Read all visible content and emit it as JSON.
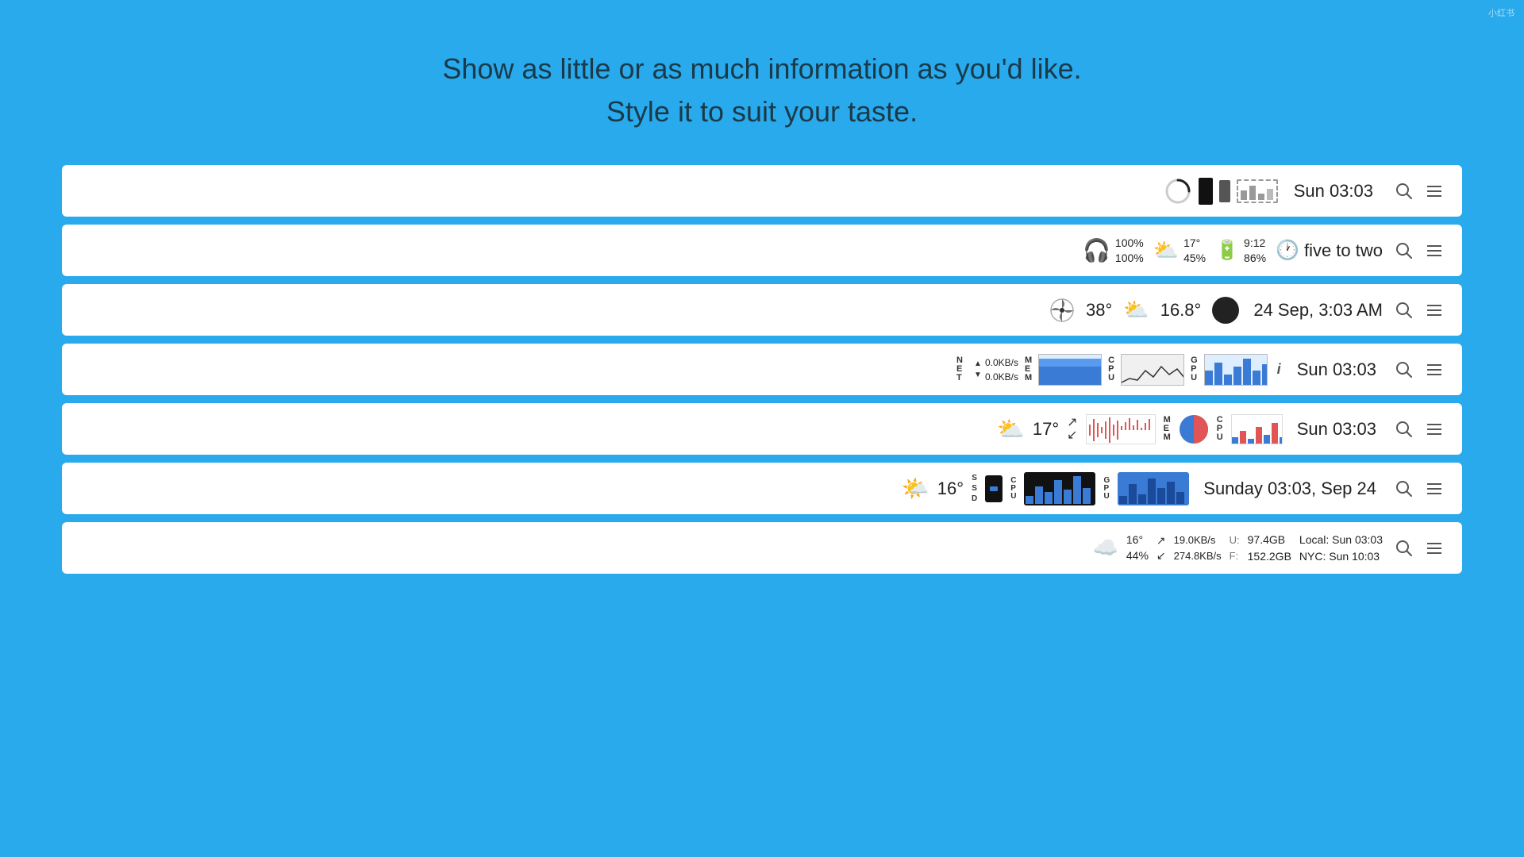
{
  "watermark": "小红书",
  "headline": {
    "line1": "Show as little or as much information as you'd like.",
    "line2": "Style it to suit your taste."
  },
  "bar1": {
    "date": "Sun 03:03"
  },
  "bar2": {
    "headphone_pct1": "100%",
    "headphone_pct2": "100%",
    "weather_temp": "17°",
    "weather_pct": "45%",
    "battery_time": "9:12",
    "battery_pct": "86%",
    "clock_text": "five to two"
  },
  "bar3": {
    "cpu_temp": "38°",
    "weather_temp": "16.8°",
    "datetime": "24 Sep, 3:03 AM"
  },
  "bar4": {
    "net_up": "0.0KB/s",
    "net_down": "0.0KB/s",
    "date": "Sun 03:03"
  },
  "bar5": {
    "temp": "17°",
    "date": "Sun 03:03"
  },
  "bar6": {
    "temp": "16°",
    "date": "Sunday 03:03, Sep 24"
  },
  "bar7": {
    "temp": "16°",
    "pct": "44%",
    "net_up": "19.0KB/s",
    "net_down": "274.8KB/s",
    "disk_used": "97.4GB",
    "disk_free": "152.2GB",
    "local_time": "Local: Sun 03:03",
    "nyc_time": "NYC: Sun 10:03"
  },
  "search_label": "🔍",
  "menu_label": "☰"
}
